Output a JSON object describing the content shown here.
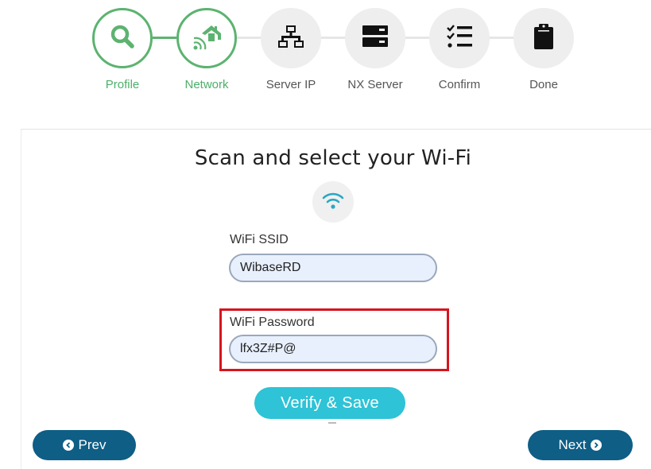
{
  "stepper": {
    "steps": [
      {
        "label": "Profile",
        "state": "done",
        "icon": "search-icon"
      },
      {
        "label": "Network",
        "state": "done",
        "icon": "home-wifi-icon"
      },
      {
        "label": "Server IP",
        "state": "pending",
        "icon": "network-icon"
      },
      {
        "label": "NX Server",
        "state": "pending",
        "icon": "server-icon"
      },
      {
        "label": "Confirm",
        "state": "pending",
        "icon": "checklist-icon"
      },
      {
        "label": "Done",
        "state": "pending",
        "icon": "clipboard-icon"
      }
    ]
  },
  "colors": {
    "step_done": "#5cb370",
    "step_pending_bg": "#eeeeee",
    "primary_nav": "#0e5e86",
    "verify": "#2ec3d6",
    "highlight": "#d7141f"
  },
  "main": {
    "title": "Scan and select your Wi-Fi",
    "wifi_icon": "wifi-icon",
    "ssid": {
      "label": "WiFi SSID",
      "value": "WibaseRD"
    },
    "password": {
      "label": "WiFi Password",
      "value": "lfx3Z#P@"
    },
    "verify_label": "Verify & Save"
  },
  "nav": {
    "prev_label": "Prev",
    "next_label": "Next"
  }
}
